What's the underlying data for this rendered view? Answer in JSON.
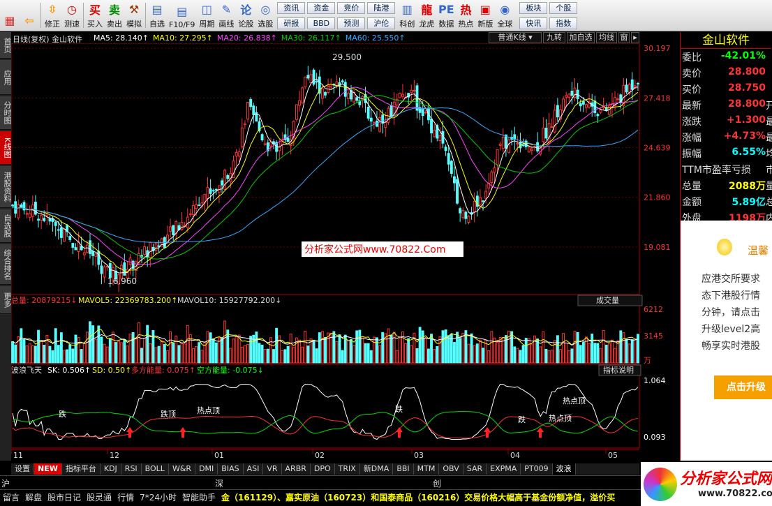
{
  "toolbar": {
    "row1": [
      "资讯",
      "资金",
      "竞价",
      "陆港"
    ],
    "row2": [
      "研报",
      "BBD",
      "预测",
      "沪伦"
    ],
    "tools": [
      {
        "label": "",
        "icon": "app-icon"
      },
      {
        "label": "",
        "icon": "back-icon"
      },
      {
        "label": "修正",
        "icon": "fix-icon"
      },
      {
        "label": "测速",
        "icon": "speed-icon"
      },
      {
        "label": "买入",
        "icon": "buy-icon"
      },
      {
        "label": "卖出",
        "icon": "sell-icon"
      },
      {
        "label": "模拟",
        "icon": "hammer-icon"
      },
      {
        "label": "自选",
        "icon": "star-icon"
      },
      {
        "label": "F10/F9",
        "icon": "f10-icon"
      },
      {
        "label": "周期",
        "icon": "period-icon"
      },
      {
        "label": "画线",
        "icon": "pen-icon"
      },
      {
        "label": "论股",
        "icon": "chat-icon"
      },
      {
        "label": "选股",
        "icon": "filter-icon"
      }
    ],
    "tools2": [
      {
        "label": "科创",
        "icon": "kc-icon"
      },
      {
        "label": "龙虎",
        "icon": "dragon-icon"
      },
      {
        "label": "数据",
        "icon": "pe-icon"
      },
      {
        "label": "热点",
        "icon": "hot-icon"
      },
      {
        "label": "新版",
        "icon": "new-icon"
      },
      {
        "label": "全球",
        "icon": "globe-icon"
      }
    ],
    "right": [
      "板块",
      "个股",
      "快讯",
      "指数"
    ]
  },
  "nav": [
    "首页",
    "应用",
    "分时图",
    "K线图",
    "港股资料",
    "自选股",
    "综合排名",
    "更多"
  ],
  "main": {
    "title": "日线(复权) 金山软件",
    "ma": [
      {
        "t": "MA5: 28.140↑",
        "c": "#ffffff"
      },
      {
        "t": "MA10: 27.295↑",
        "c": "#ffff00"
      },
      {
        "t": "MA20: 26.838↑",
        "c": "#ff44ff"
      },
      {
        "t": "MA30: 26.117↑",
        "c": "#00cc00"
      },
      {
        "t": "MA60: 25.550↑",
        "c": "#33aaff"
      }
    ],
    "kline_type": "普通K线",
    "buttons": [
      "九转",
      "加自选",
      "均线",
      "窗"
    ],
    "price_ticks": [
      "30.197",
      "27.418",
      "24.639",
      "21.860",
      "19.081"
    ],
    "high_label": "29.500",
    "low_label": "16.960",
    "watermark": "分析家公式网www.70822.Com"
  },
  "volume": {
    "label": "总量: 20879215↓",
    "ma5": "MAVOL5: 22369783.200↑",
    "ma10": "MAVOL10: 15927792.200↓",
    "selector": "成交量",
    "ticks": [
      "6212",
      "3145"
    ],
    "unit": "万"
  },
  "indicator": {
    "name": "波浪飞天",
    "sk": "SK: 0.506↑",
    "sd": "SD: 0.50↑",
    "duo": "多方能量: 0.075↑",
    "kong": "空方能量: -0.075↓",
    "help": "指标说明",
    "ticks": [
      "1.064",
      "0.093"
    ],
    "labels": [
      "跌",
      "跌顶",
      "热点顶",
      "跌",
      "跌",
      "热点顶",
      "热点顶"
    ]
  },
  "xaxis": [
    "11",
    "12",
    "01",
    "02",
    "03",
    "04",
    "05"
  ],
  "quote": {
    "name": "金山软件",
    "rows": [
      {
        "l": "委比",
        "v": "-42.01%",
        "c": "#00ff00",
        "u": ""
      },
      {
        "l": "卖价",
        "v": "28.800",
        "c": "#ff3333",
        "u": ""
      },
      {
        "l": "买价",
        "v": "28.750",
        "c": "#ff3333",
        "u": ""
      },
      {
        "l": "最新",
        "v": "28.800",
        "c": "#ff3333",
        "u": "开"
      },
      {
        "l": "涨跌",
        "v": "+1.300",
        "c": "#ff3333",
        "u": "最"
      },
      {
        "l": "涨幅",
        "v": "+4.73%",
        "c": "#ff3333",
        "u": "最"
      },
      {
        "l": "振幅",
        "v": "6.55%",
        "c": "#00ffff",
        "u": "均"
      },
      {
        "l": "TTM市盈率亏损",
        "v": "",
        "c": "#dddddd",
        "u": "市"
      },
      {
        "l": "总量",
        "v": "2088万",
        "c": "#ffff00",
        "u": "量"
      },
      {
        "l": "金额",
        "v": "5.89亿",
        "c": "#00ffff",
        "u": "总"
      },
      {
        "l": "外盘",
        "v": "1198万",
        "c": "#ff3333",
        "u": "内"
      }
    ],
    "promo_title": "温馨",
    "promo_text": [
      "应港交所要求",
      "态下港股行情",
      "分钟，请点击",
      "升级level2高",
      "畅享实时港股"
    ],
    "promo_btn": "点击升级"
  },
  "tabs": [
    "设置",
    "NEW",
    "指标平台",
    "KDJ",
    "RSI",
    "BOLL",
    "W&R",
    "DMI",
    "BIAS",
    "ASI",
    "VR",
    "ARBR",
    "DPO",
    "TRIX",
    "新DMA",
    "BBI",
    "MTM",
    "OBV",
    "SAR",
    "EXPMA",
    "PT009",
    "波浪"
  ],
  "bottom1": [
    "沪",
    "深",
    "创"
  ],
  "bottom2": [
    "留言",
    "解盘",
    "股市日记",
    "股灵通",
    "行情",
    "7*24小时",
    "智能助手"
  ],
  "ticker": "金（161129）、嘉实原油（160723）和国泰商品（160216）交易价格大幅高于基金份额净值，溢价买",
  "logo": {
    "text": "分析家公式网",
    "url": "www.70822.com"
  }
}
